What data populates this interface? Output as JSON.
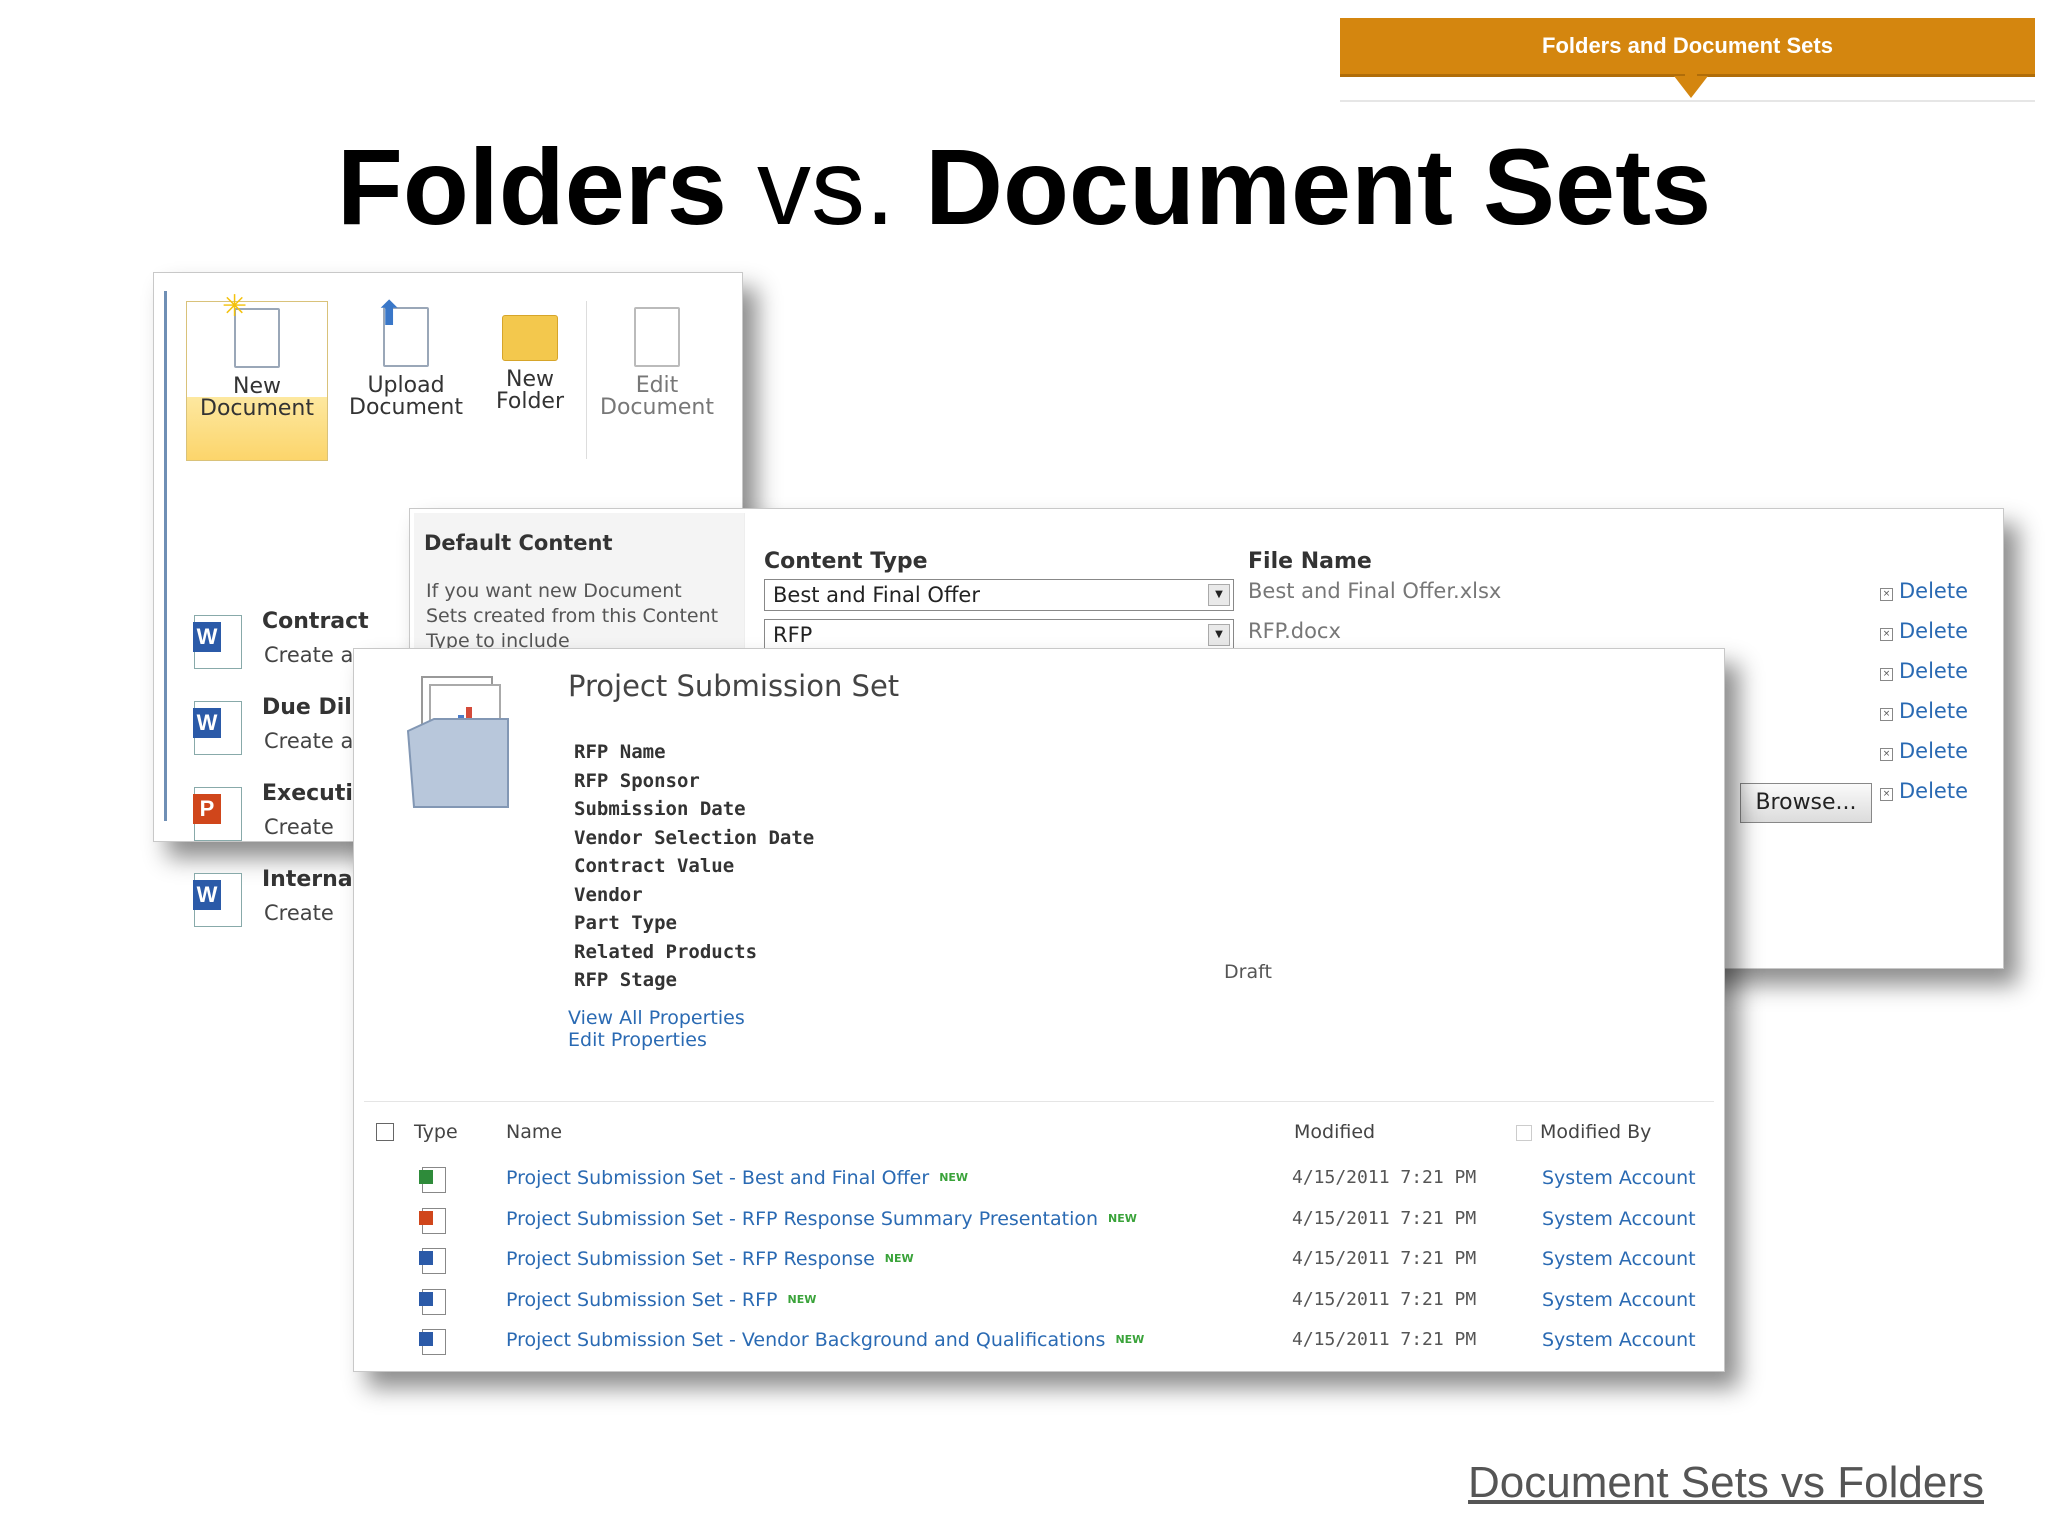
{
  "banner": {
    "label": "Folders and Document Sets"
  },
  "title": {
    "part1": "Folders",
    "part2": " vs. ",
    "part3": "Document Sets"
  },
  "ribbon": {
    "new_document": "New\nDocument",
    "upload_document": "Upload\nDocument",
    "new_folder": "New\nFolder",
    "edit_document": "Edit\nDocument",
    "menu": [
      {
        "title": "Contract",
        "desc": "Create a new Contract",
        "type": "W"
      },
      {
        "title": "Due Diligen",
        "desc": "Create a ne",
        "type": "W"
      },
      {
        "title": "Executive R",
        "desc": "Create",
        "type": "P"
      },
      {
        "title": "Interna",
        "desc": "Create",
        "type": "W"
      }
    ]
  },
  "default_content": {
    "heading": "Default Content",
    "description": "If you want new Document Sets created from this Content Type to include",
    "content_type_header": "Content Type",
    "file_name_header": "File Name",
    "rows": [
      {
        "content_type": "Best and Final Offer",
        "file_name": "Best and Final Offer.xlsx"
      },
      {
        "content_type": "RFP",
        "file_name": "RFP.docx"
      }
    ],
    "delete_label": "Delete",
    "browse_label": "Browse..."
  },
  "submission_set": {
    "title": "Project Submission Set",
    "properties": [
      "RFP Name",
      "RFP Sponsor",
      "Submission Date",
      "Vendor Selection Date",
      "Contract Value",
      "Vendor",
      "Part Type",
      "Related Products",
      "RFP Stage"
    ],
    "rfp_stage_value": "Draft",
    "view_all": "View All Properties",
    "edit_props": "Edit Properties",
    "columns": {
      "type": "Type",
      "name": "Name",
      "modified": "Modified",
      "modified_by": "Modified By"
    },
    "new_tag": "NEW",
    "rows": [
      {
        "name": "Project Submission Set - Best and Final Offer",
        "modified": "4/15/2011 7:21 PM",
        "by": "System Account",
        "kind": "xlsx"
      },
      {
        "name": "Project Submission Set - RFP Response Summary Presentation",
        "modified": "4/15/2011 7:21 PM",
        "by": "System Account",
        "kind": "pptx"
      },
      {
        "name": "Project Submission Set - RFP Response",
        "modified": "4/15/2011 7:21 PM",
        "by": "System Account",
        "kind": "docx"
      },
      {
        "name": "Project Submission Set - RFP",
        "modified": "4/15/2011 7:21 PM",
        "by": "System Account",
        "kind": "docx"
      },
      {
        "name": "Project Submission Set - Vendor Background and Qualifications",
        "modified": "4/15/2011 7:21 PM",
        "by": "System Account",
        "kind": "docx"
      }
    ]
  },
  "footer": {
    "link": "Document Sets vs Folders"
  },
  "colors": {
    "banner": "#d4860f",
    "link": "#2a6ab3",
    "new_tag": "#3aa33a",
    "word": "#2b5aa8",
    "powerpoint": "#d0461b",
    "excel": "#2e8b3a"
  }
}
